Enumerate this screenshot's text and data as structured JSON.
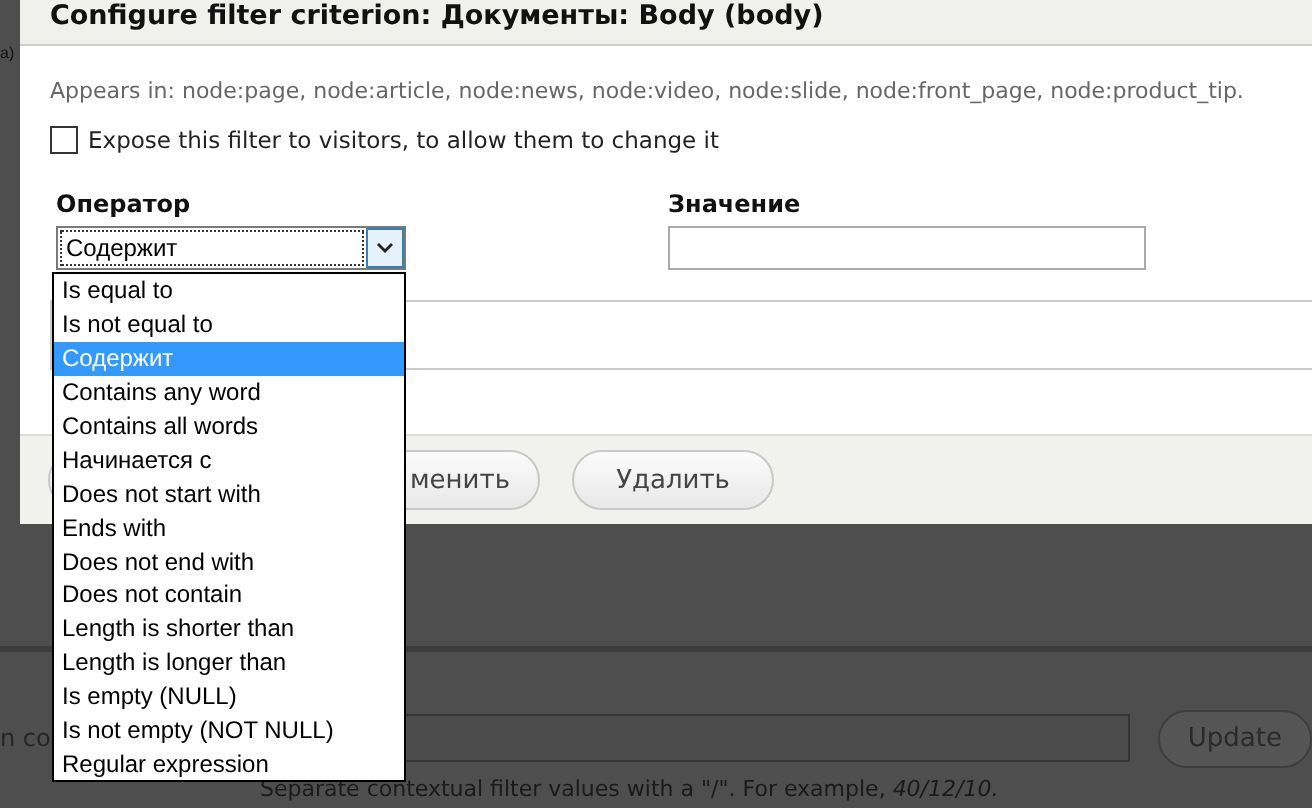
{
  "background_page": {
    "fragment": "a)",
    "field_label": "n co",
    "update_button": "Update",
    "hint": "Separate contextual filter values with a \"/\". For example, *40/12/10.*"
  },
  "dialog": {
    "title": "Configure filter criterion: Документы: Body (body)",
    "appears_in": "Appears in: node:page, node:article, node:news, node:video, node:slide, node:front_page, node:product_tip.",
    "expose": {
      "label": "Expose this filter to visitors, to allow them to change it",
      "checked": false
    },
    "operator": {
      "label": "Оператор",
      "value": "Содержит",
      "expanded": true,
      "options": [
        {
          "label": "Is equal to",
          "selected": false
        },
        {
          "label": "Is not equal to",
          "selected": false
        },
        {
          "label": "Содержит",
          "selected": true
        },
        {
          "label": "Contains any word",
          "selected": false
        },
        {
          "label": "Contains all words",
          "selected": false
        },
        {
          "label": "Начинается с",
          "selected": false
        },
        {
          "label": "Does not start with",
          "selected": false
        },
        {
          "label": "Ends with",
          "selected": false
        },
        {
          "label": "Does not end with",
          "selected": false
        },
        {
          "label": "Does not contain",
          "selected": false
        },
        {
          "label": "Length is shorter than",
          "selected": false
        },
        {
          "label": "Length is longer than",
          "selected": false
        },
        {
          "label": "Is empty (NULL)",
          "selected": false
        },
        {
          "label": "Is not empty (NOT NULL)",
          "selected": false
        },
        {
          "label": "Regular expression",
          "selected": false
        }
      ]
    },
    "value_field": {
      "label": "Значение"
    },
    "buttons": [
      "менить",
      "Удалить"
    ]
  }
}
